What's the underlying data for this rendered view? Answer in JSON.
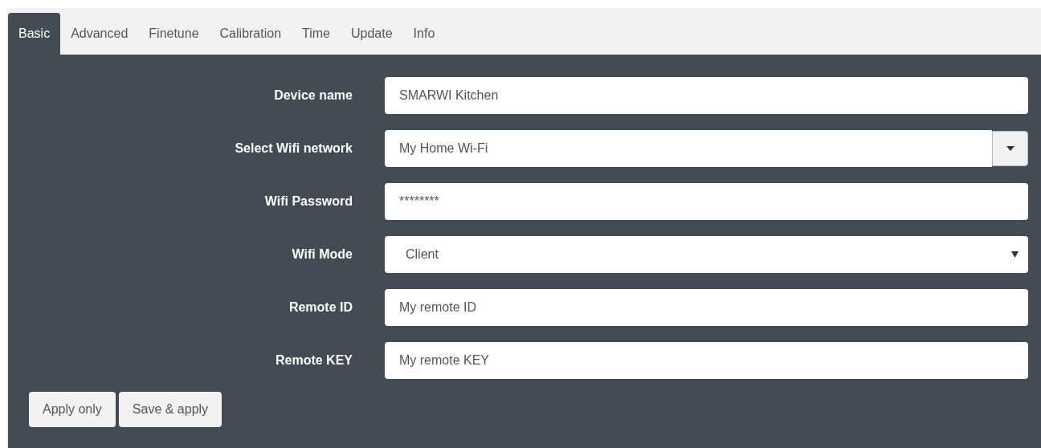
{
  "tabs": [
    {
      "label": "Basic",
      "selected": true
    },
    {
      "label": "Advanced",
      "selected": false
    },
    {
      "label": "Finetune",
      "selected": false
    },
    {
      "label": "Calibration",
      "selected": false
    },
    {
      "label": "Time",
      "selected": false
    },
    {
      "label": "Update",
      "selected": false
    },
    {
      "label": "Info",
      "selected": false
    }
  ],
  "fields": [
    {
      "label": "Device name",
      "kind": "text",
      "value": "SMARWI Kitchen"
    },
    {
      "label": "Select Wifi network",
      "kind": "combo",
      "value": "My Home Wi-Fi"
    },
    {
      "label": "Wifi Password",
      "kind": "password",
      "value": "********"
    },
    {
      "label": "Wifi Mode",
      "kind": "select",
      "value": "Client"
    },
    {
      "label": "Remote ID",
      "kind": "text",
      "value": "My remote ID"
    },
    {
      "label": "Remote KEY",
      "kind": "text",
      "value": "My remote KEY"
    }
  ],
  "buttons": [
    "Apply only",
    "Save & apply"
  ]
}
